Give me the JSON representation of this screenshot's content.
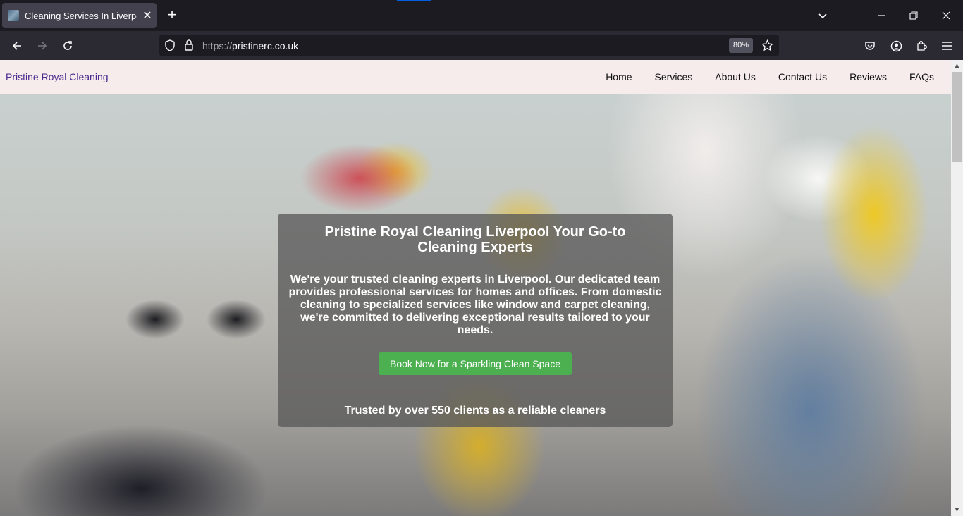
{
  "browser": {
    "tab": {
      "title": "Cleaning Services In Liverpool",
      "close_symbol": "✕"
    },
    "new_tab_symbol": "+",
    "url": {
      "scheme": "https://",
      "host": "pristinerc.co.uk"
    },
    "zoom": "80%"
  },
  "site": {
    "brand": "Pristine Royal Cleaning",
    "nav": [
      "Home",
      "Services",
      "About Us",
      "Contact Us",
      "Reviews",
      "FAQs"
    ],
    "hero": {
      "title": "Pristine Royal Cleaning Liverpool Your Go-to Cleaning Experts",
      "description": "We're your trusted cleaning experts in Liverpool. Our dedicated team provides professional services for homes and offices. From domestic cleaning to specialized services like window and carpet cleaning, we're committed to delivering exceptional results tailored to your needs.",
      "cta": "Book Now for a Sparkling Clean Space",
      "trusted": "Trusted by over 550 clients as a reliable cleaners"
    }
  },
  "colors": {
    "header_bg": "#f7ecec",
    "brand_text": "#4b2a8e",
    "cta_bg": "#4caf50",
    "browser_bg": "#1c1b22"
  }
}
